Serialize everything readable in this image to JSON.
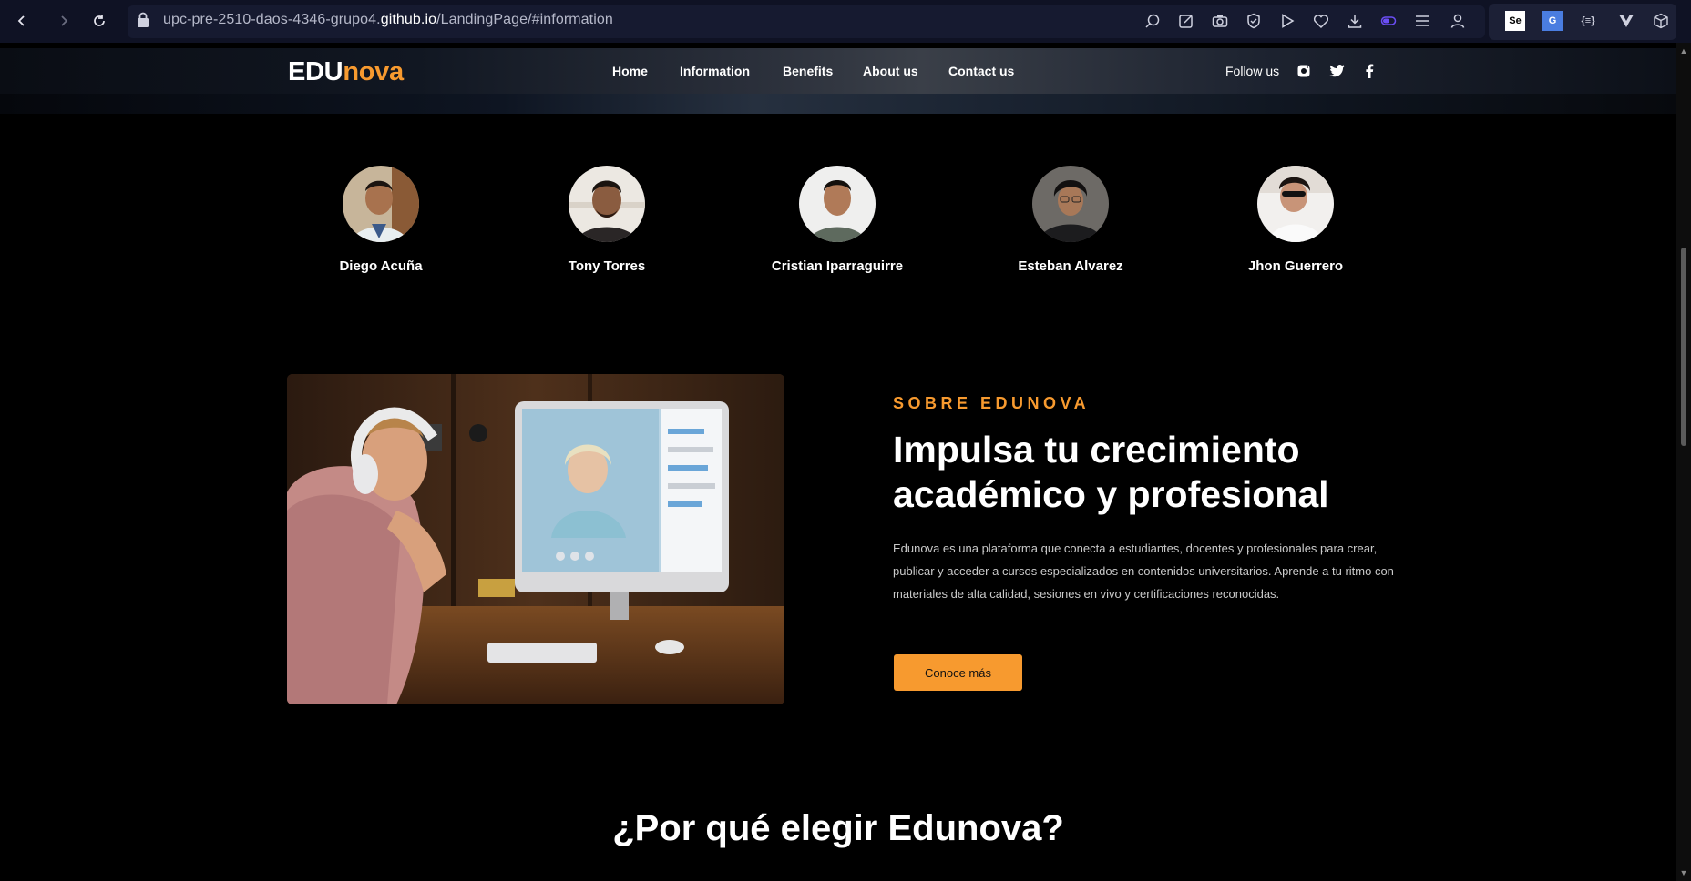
{
  "browser": {
    "url_prefix": "upc-pre-2510-daos-4346-grupo4.",
    "url_domain": "github.io",
    "url_path": "/LandingPage/#information"
  },
  "header": {
    "logo_main": "EDU",
    "logo_accent": "nova",
    "nav": [
      "Home",
      "Information",
      "Benefits",
      "About us",
      "Contact us"
    ],
    "follow_label": "Follow us"
  },
  "team": {
    "members": [
      {
        "name": "Diego Acuña"
      },
      {
        "name": "Tony Torres"
      },
      {
        "name": "Cristian Iparraguirre"
      },
      {
        "name": "Esteban Alvarez"
      },
      {
        "name": "Jhon Guerrero"
      }
    ]
  },
  "about": {
    "eyebrow": "SOBRE EDUNOVA",
    "title": "Impulsa tu crecimiento académico y profesional",
    "text": "Edunova es una plataforma que conecta a estudiantes, docentes y profesionales para crear, publicar y acceder a cursos especializados en contenidos universitarios. Aprende a tu ritmo con materiales de alta calidad, sesiones en vivo y certificaciones reconocidas.",
    "cta": "Conoce más"
  },
  "why": {
    "title": "¿Por qué elegir Edunova?"
  },
  "colors": {
    "accent": "#f79a2f",
    "background": "#000000"
  }
}
